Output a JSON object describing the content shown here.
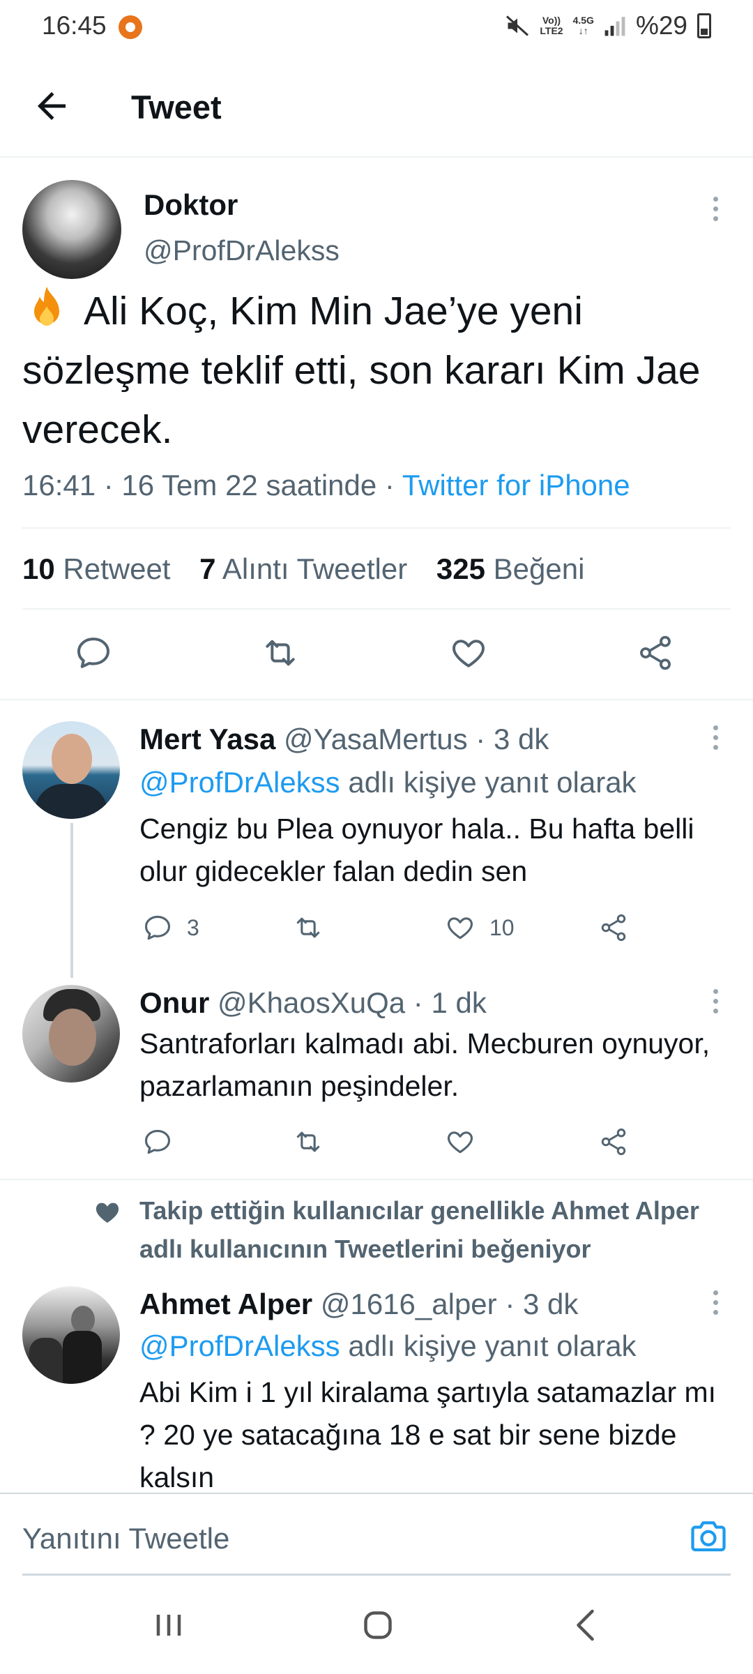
{
  "status_bar": {
    "time": "16:45",
    "volte": "Vo))\nLTE2",
    "network": "4.5G\n↓↑",
    "battery": "%29"
  },
  "header": {
    "title": "Tweet"
  },
  "main_tweet": {
    "name": "Doktor",
    "handle": "@ProfDrAlekss",
    "text": "Ali Koç, Kim Min Jae’ye yeni sözleşme teklif etti, son kararı Kim Jae verecek.",
    "time": "16:41 · 16 Tem 22 saatinde · ",
    "source": "Twitter for iPhone",
    "retweets_count": "10",
    "retweets_label": "Retweet",
    "quotes_count": "7",
    "quotes_label": "Alıntı Tweetler",
    "likes_count": "325",
    "likes_label": "Beğeni"
  },
  "replies": [
    {
      "name": "Mert Yasa",
      "handle": "@YasaMertus · 3 dk",
      "reply_to": "@ProfDrAlekss",
      "reply_suffix": " adlı kişiye yanıt olarak",
      "text": "Cengiz bu Plea oynuyor hala.. Bu hafta belli olur gidecekler falan dedin sen",
      "reply_count": "3",
      "like_count": "10"
    },
    {
      "name": "Onur",
      "handle": "@KhaosXuQa · 1 dk",
      "text": "Santraforları kalmadı abi. Mecburen oynuyor, pazarlamanın peşindeler."
    },
    {
      "social_context": "Takip ettiğin kullanıcılar genellikle Ahmet Alper adlı kullanıcının Tweetlerini beğeniyor",
      "name": "Ahmet Alper",
      "handle": "@1616_alper · 3 dk",
      "reply_to": "@ProfDrAlekss",
      "reply_suffix": " adlı kişiye yanıt olarak",
      "text": "Abi Kim i 1 yıl kiralama şartıyla satamazlar mı ? 20 ye satacağına 18 e sat bir sene bizde kalsın"
    }
  ],
  "compose": {
    "placeholder": "Yanıtını Tweetle"
  },
  "icons": {
    "accent": "#1d9bf0",
    "grey": "#536471"
  }
}
